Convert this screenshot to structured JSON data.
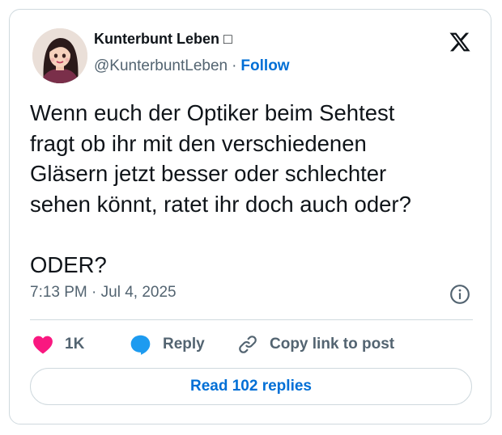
{
  "author": {
    "display_name": "Kunterbunt Leben",
    "name_emoji": "□",
    "handle": "@KunterbuntLeben",
    "separator": "·",
    "follow_label": "Follow"
  },
  "tweet": {
    "lines": [
      "Wenn euch der Optiker beim Sehtest",
      "fragt ob ihr mit den verschiedenen",
      "Gläsern jetzt besser oder schlechter",
      "sehen könnt, ratet ihr doch auch oder?"
    ],
    "last_line": "ODER?",
    "timestamp": "7:13 PM · Jul 4, 2025"
  },
  "actions": {
    "likes_count": "1K",
    "reply_label": "Reply",
    "copy_link_label": "Copy link to post"
  },
  "footer": {
    "read_replies_label": "Read 102 replies"
  },
  "icons": {
    "platform_logo": "x-logo-icon",
    "info": "info-icon",
    "like": "heart-icon",
    "reply": "speech-bubble-icon",
    "copy_link": "link-icon"
  },
  "colors": {
    "like": "#f91880",
    "reply": "#1d9bf0",
    "link": "#006fd6",
    "muted": "#536471",
    "border": "#cfd9de"
  }
}
